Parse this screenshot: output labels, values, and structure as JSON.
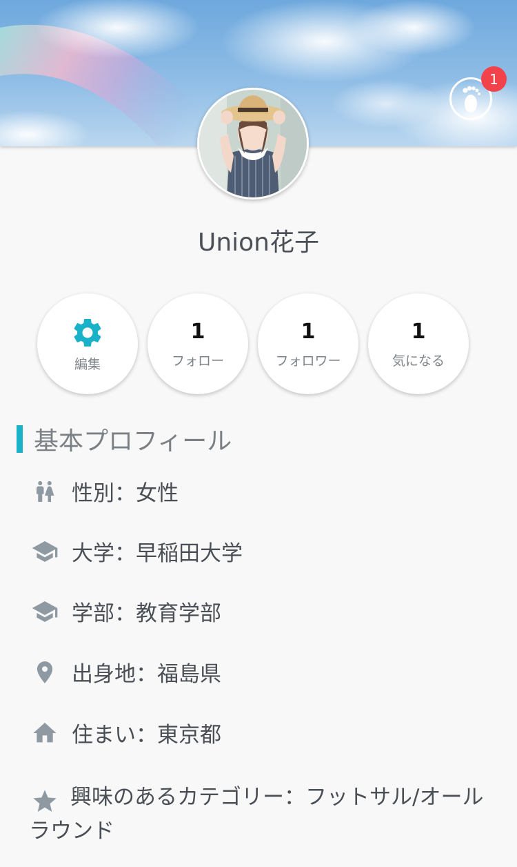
{
  "header": {
    "notification_count": "1",
    "footprint_icon": "footprint-icon"
  },
  "profile": {
    "name": "Union花子"
  },
  "stats": [
    {
      "icon": "gear-icon",
      "label": "編集"
    },
    {
      "value": "1",
      "label": "フォロー"
    },
    {
      "value": "1",
      "label": "フォロワー"
    },
    {
      "value": "1",
      "label": "気になる"
    }
  ],
  "section": {
    "title": "基本プロフィール"
  },
  "details": [
    {
      "icon": "gender-icon",
      "text": "性別：女性"
    },
    {
      "icon": "graduation-cap-icon",
      "text": "大学：早稲田大学"
    },
    {
      "icon": "graduation-cap-icon",
      "text": "学部：教育学部"
    },
    {
      "icon": "location-pin-icon",
      "text": "出身地：福島県"
    },
    {
      "icon": "home-icon",
      "text": "住まい：東京都"
    },
    {
      "icon": "star-icon",
      "text": "興味のあるカテゴリー：フットサル/オールラウンド"
    }
  ],
  "colors": {
    "accent": "#19b2c8",
    "badge": "#f2434a",
    "icon_gray": "#8f99a1",
    "text": "#4a4f55"
  }
}
